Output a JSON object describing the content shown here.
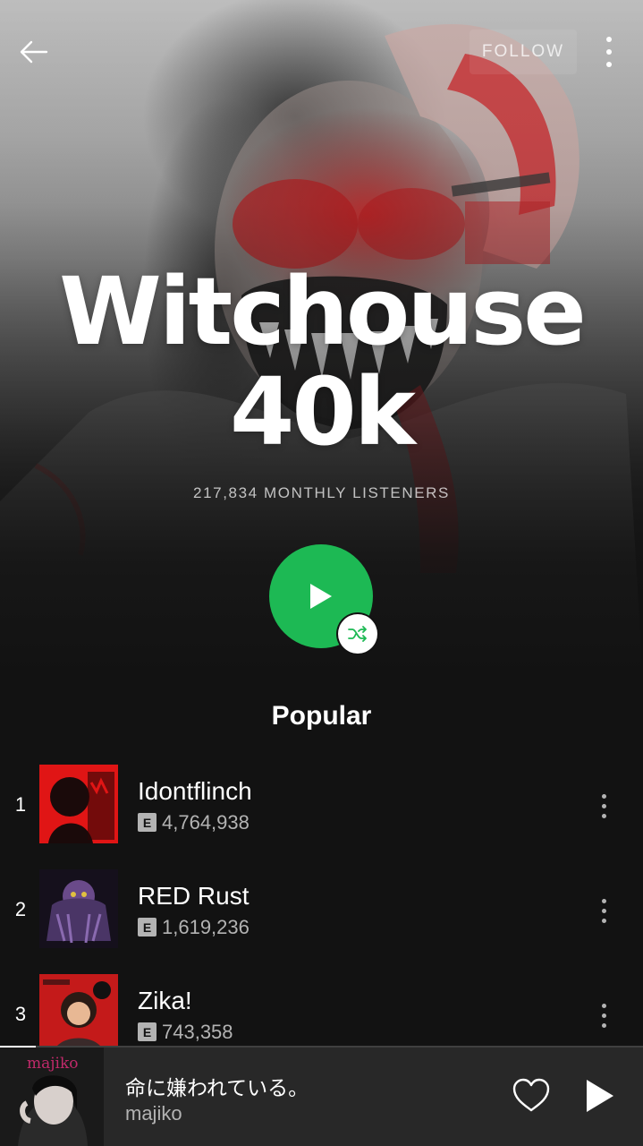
{
  "header": {
    "follow_label": "FOLLOW",
    "back_icon": "arrow-left-icon",
    "more_icon": "more-vertical-icon"
  },
  "artist": {
    "name_line1": "Witchouse",
    "name_line2": "40k",
    "monthly_listeners": "217,834 MONTHLY LISTENERS"
  },
  "popular": {
    "title": "Popular",
    "tracks": [
      {
        "rank": "1",
        "name": "Idontflinch",
        "explicit": "E",
        "plays": "4,764,938"
      },
      {
        "rank": "2",
        "name": "RED Rust",
        "explicit": "E",
        "plays": "1,619,236"
      },
      {
        "rank": "3",
        "name": "Zika!",
        "explicit": "E",
        "plays": "743,358"
      }
    ]
  },
  "now_playing": {
    "title": "命に嫌われている。",
    "artist": "majiko",
    "cover_text": "majiko",
    "progress": 0.055
  },
  "colors": {
    "accent_green": "#1db954",
    "background": "#121212",
    "bar_background": "#282828",
    "secondary_text": "#b3b3b3"
  }
}
